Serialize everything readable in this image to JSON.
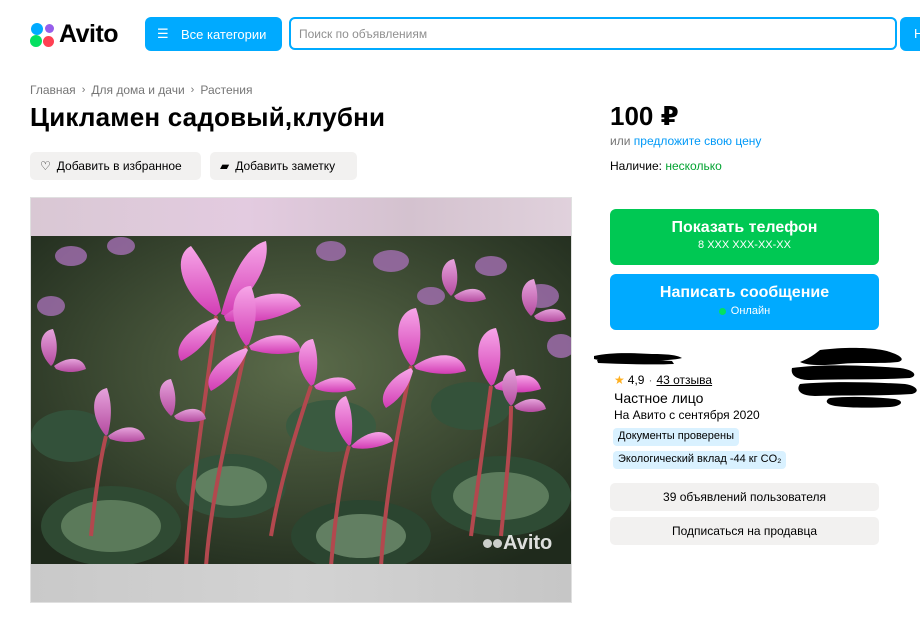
{
  "header": {
    "logo_text": "Avito",
    "categories_label": "Все категории",
    "search_placeholder": "Поиск по объявлениям",
    "search_button_label": "Н"
  },
  "breadcrumb": {
    "items": [
      "Главная",
      "Для дома и дачи",
      "Растения"
    ]
  },
  "listing": {
    "title": "Цикламен садовый,клубни",
    "add_favorite_label": "Добавить в избранное",
    "add_note_label": "Добавить заметку",
    "watermark": "Avito"
  },
  "pricing": {
    "price": "100 ₽",
    "or_text": "или",
    "offer_link": "предложите свою цену",
    "availability_label": "Наличие:",
    "availability_value": "несколько"
  },
  "actions": {
    "show_phone_label": "Показать телефон",
    "phone_masked": "8 XXX XXX-XX-XX",
    "write_message_label": "Написать сообщение",
    "online_status": "Онлайн"
  },
  "seller": {
    "rating": "4,9",
    "reviews": "43 отзыва",
    "type": "Частное лицо",
    "since": "На Авито с сентября 2020",
    "badges": [
      "Документы проверены",
      "Экологический вклад -44 кг CO₂"
    ],
    "listings_button": "39 объявлений пользователя",
    "subscribe_button": "Подписаться на продавца"
  },
  "colors": {
    "brand_blue": "#00aaff",
    "call_green": "#00c853",
    "availability_green": "#02a331",
    "link_blue": "#0099f7",
    "chip_grey": "#f2f1f0",
    "badge_blue": "#d9f1ff"
  }
}
